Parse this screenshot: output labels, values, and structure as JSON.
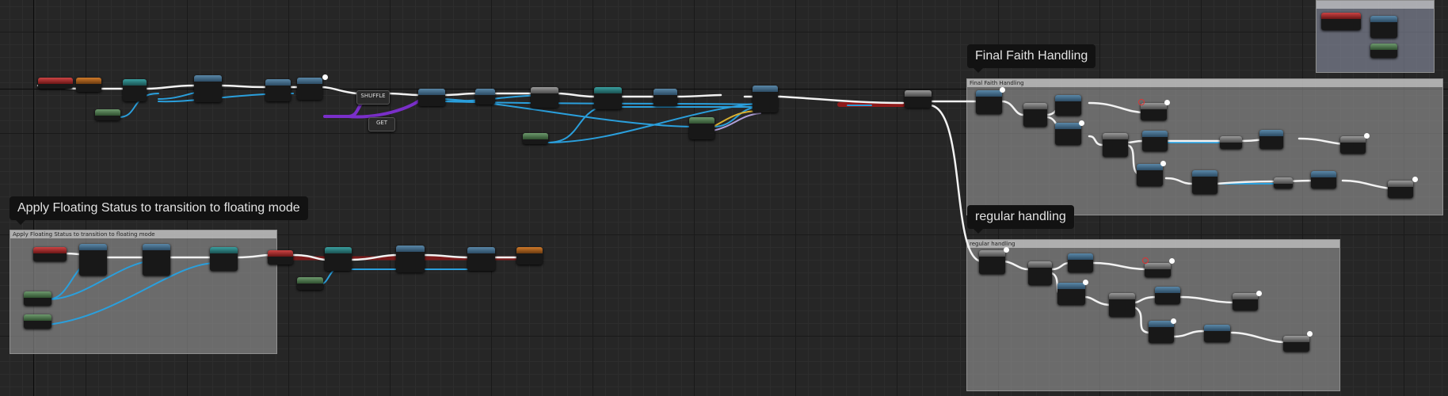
{
  "comments": {
    "final_faith": "Final Faith Handling",
    "regular": "regular handling",
    "floating": "Apply Floating Status to transition to floating mode",
    "floating_header": "Apply Floating Status to transition to floating mode"
  },
  "nodes": {
    "shuffle": "SHUFFLE",
    "get": "GET"
  },
  "colors": {
    "exec_wire": "#f2f2f2",
    "object_wire": "#2a9fdc",
    "array_wire": "#7a2fc9",
    "bool_wire": "#8f1a1a",
    "yellow_wire": "#d8b030"
  }
}
